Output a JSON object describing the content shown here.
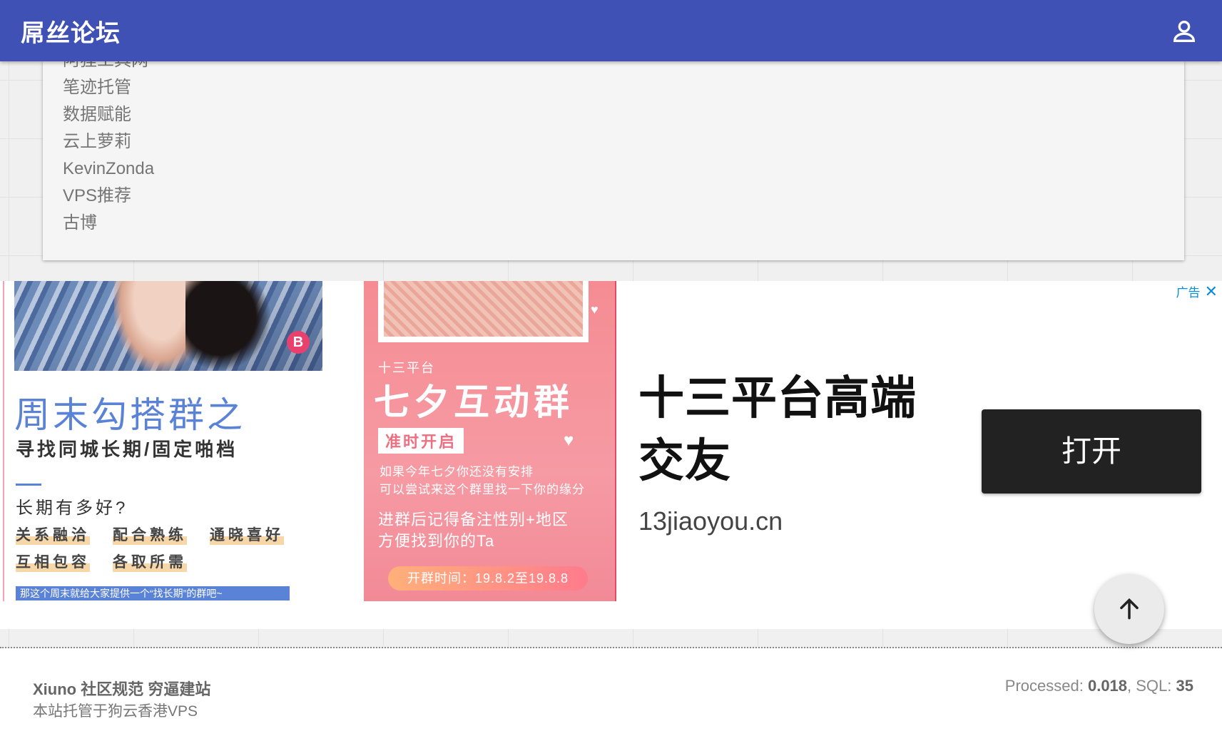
{
  "header": {
    "title": "屌丝论坛",
    "user_icon": "account-icon",
    "color": "#3f51b5"
  },
  "friend_links": [
    "阿狸工具网",
    "笔迹托管",
    "数据赋能",
    "云上萝莉",
    "KevinZonda",
    "VPS推荐",
    "古博"
  ],
  "ad": {
    "tag": "广告",
    "close_icon": "close-icon",
    "left_panel": {
      "title": "周末勾搭群之",
      "subtitle": "寻找同城长期/固定啪档",
      "question": "长期有多好?",
      "tags": [
        "关系融洽",
        "配合熟练",
        "通晓喜好",
        "互相包容",
        "各取所需"
      ],
      "footer": "那这个周末就给大家提供一个“找长期”的群吧~"
    },
    "middle_panel": {
      "platform": "十三平台",
      "title": "七夕互动群",
      "badge": "准时开启",
      "paragraph1": "如果今年七夕你还没有安排\n可以尝试来这个群里找一下你的缘分",
      "paragraph2": "进群后记得备注性别+地区\n方便找到你的Ta",
      "time": "开群时间：19.8.2至19.8.8"
    },
    "headline": "十三平台高端交友",
    "domain": "13jiaoyou.cn",
    "open_button": "打开"
  },
  "footer": {
    "links": [
      "Xiuno",
      "社区规范",
      "穷逼建站"
    ],
    "hosting": "本站托管于狗云香港VPS",
    "stats_processed_label": "Processed:",
    "stats_processed_value": "0.018",
    "stats_sql_label": ", SQL:",
    "stats_sql_value": "35"
  },
  "back_to_top_icon": "arrow-up-icon"
}
